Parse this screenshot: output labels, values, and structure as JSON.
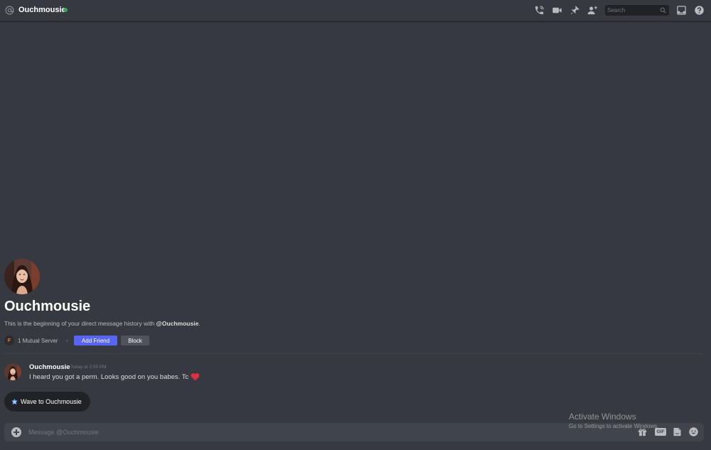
{
  "header": {
    "username": "Ouchmousie",
    "status_color": "#3ba55d",
    "search_placeholder": "Search",
    "icons": [
      "at-icon",
      "start-voice-call-icon",
      "start-video-call-icon",
      "pinned-messages-icon",
      "add-friends-to-dm-icon",
      "search-icon",
      "inbox-icon",
      "help-icon"
    ]
  },
  "intro": {
    "name": "Ouchmousie",
    "description_prefix": "This is the beginning of your direct message history with ",
    "description_handle": "@Ouchmousie",
    "description_suffix": ".",
    "server_initial": "F",
    "mutual_servers": "1 Mutual Server",
    "add_friend_label": "Add Friend",
    "block_label": "Block"
  },
  "message": {
    "author": "Ouchmousie",
    "timestamp": "Today at 2:55 PM",
    "text": "I heard you got a perm. Looks good on you babes. Tc"
  },
  "wave_button": {
    "label": "Wave to Ouchmousie"
  },
  "watermark": {
    "title": "Activate Windows",
    "subtitle": "Go to Settings to activate Windows."
  },
  "composer": {
    "placeholder": "Message @Ouchmousie",
    "icons": [
      "add-attachment-icon",
      "gift-icon",
      "gif-icon",
      "sticker-icon",
      "emoji-icon"
    ],
    "gif_label": "GIF"
  },
  "colors": {
    "background": "#36393f",
    "accent": "#5865f2",
    "secondary_button": "#4f545c",
    "input_background": "#40444b"
  }
}
